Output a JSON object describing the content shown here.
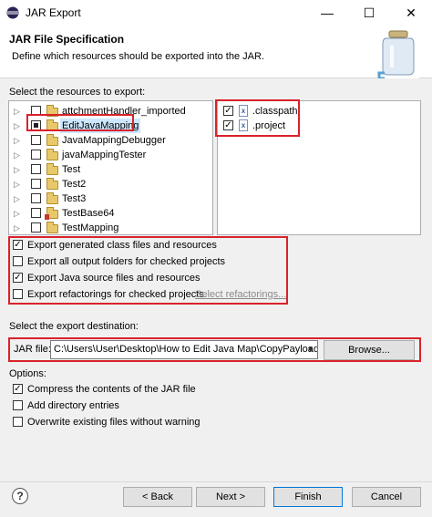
{
  "window": {
    "title": "JAR Export",
    "minimize": "—",
    "maximize": "☐",
    "close": "✕"
  },
  "header": {
    "title": "JAR File Specification",
    "description": "Define which resources should be exported into the JAR."
  },
  "resources": {
    "label": "Select the resources to export:",
    "tree": [
      {
        "label": "attchmentHandler_imported",
        "checked": false
      },
      {
        "label": "EditJavaMapping",
        "checked": "partial",
        "selected": true
      },
      {
        "label": "JavaMappingDebugger",
        "checked": false
      },
      {
        "label": "javaMappingTester",
        "checked": false
      },
      {
        "label": "Test",
        "checked": false
      },
      {
        "label": "Test2",
        "checked": false
      },
      {
        "label": "Test3",
        "checked": false
      },
      {
        "label": "TestBase64",
        "checked": false,
        "error": true
      },
      {
        "label": "TestMapping",
        "checked": false
      }
    ],
    "files": [
      {
        "label": ".classpath",
        "checked": true
      },
      {
        "label": ".project",
        "checked": true
      }
    ]
  },
  "export_options": [
    {
      "label": "Export generated class files and resources",
      "checked": true
    },
    {
      "label": "Export all output folders for checked projects",
      "checked": false
    },
    {
      "label": "Export Java source files and resources",
      "checked": true
    },
    {
      "label": "Export refactorings for checked projects.",
      "checked": false
    }
  ],
  "select_refactorings_link": "Select refactorings...",
  "destination": {
    "label": "Select the export destination:",
    "jar_label": "JAR file:",
    "jar_path": "C:\\Users\\User\\Desktop\\How to Edit Java Map\\CopyPayload.jar",
    "browse": "Browse..."
  },
  "options": {
    "label": "Options:",
    "items": [
      {
        "label": "Compress the contents of the JAR file",
        "checked": true
      },
      {
        "label": "Add directory entries",
        "checked": false
      },
      {
        "label": "Overwrite existing files without warning",
        "checked": false
      }
    ]
  },
  "buttons": {
    "help": "?",
    "back": "< Back",
    "next": "Next >",
    "finish": "Finish",
    "cancel": "Cancel"
  },
  "colors": {
    "highlight": "#d9222a",
    "selection": "#cce8ff",
    "accent": "#0078d7"
  }
}
